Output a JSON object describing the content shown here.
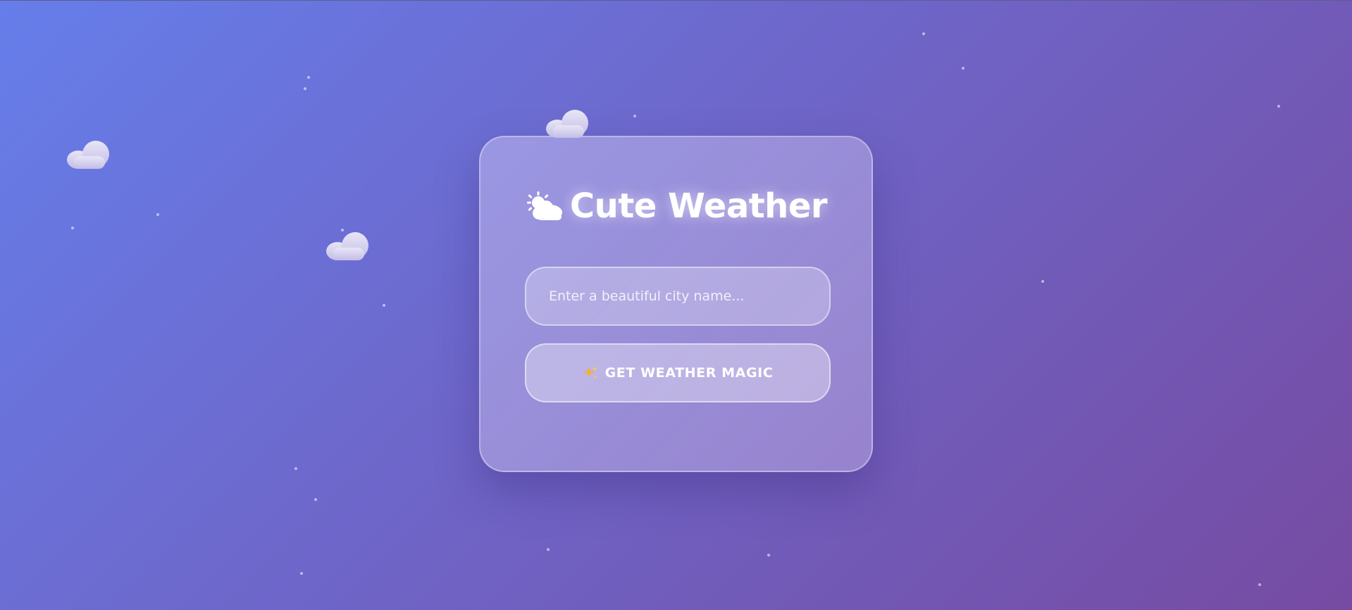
{
  "app": {
    "title": "Cute Weather",
    "title_icon": "sun-behind-cloud-icon"
  },
  "search": {
    "placeholder": "Enter a beautiful city name...",
    "value": ""
  },
  "action": {
    "label": "GET WEATHER MAGIC",
    "icon": "sparkles-icon"
  },
  "colors": {
    "background_start": "#667eea",
    "background_end": "#764ba2",
    "text": "#ffffff"
  },
  "decorations": {
    "cloud_icon": "cloud-icon",
    "sparkle_icon": "sparkle-dot"
  }
}
